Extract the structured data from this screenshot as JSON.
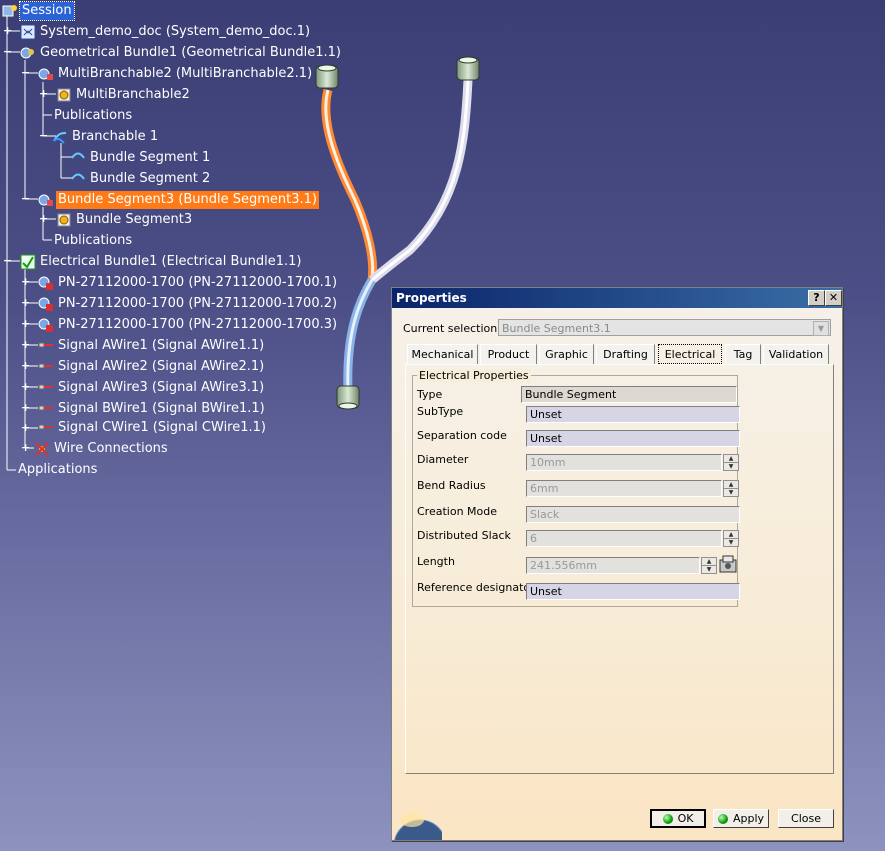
{
  "tree": {
    "items": [
      {
        "label": "Session",
        "icon": "session-icon"
      },
      {
        "label": "System_demo_doc (System_demo_doc.1)",
        "icon": "document-icon"
      },
      {
        "label": "Geometrical Bundle1 (Geometrical Bundle1.1)",
        "icon": "geometrical-bundle-icon"
      },
      {
        "label": "MultiBranchable2 (MultiBranchable2.1)",
        "icon": "multibranchable-product-icon"
      },
      {
        "label": "MultiBranchable2",
        "icon": "gear-part-icon"
      },
      {
        "label": "Publications",
        "icon": ""
      },
      {
        "label": "Branchable 1",
        "icon": "branchable-icon"
      },
      {
        "label": "Bundle Segment 1",
        "icon": "bundle-segment-icon"
      },
      {
        "label": "Bundle Segment 2",
        "icon": "bundle-segment-icon"
      },
      {
        "label": "Bundle Segment3 (Bundle Segment3.1)",
        "icon": "bundle-segment-product-icon"
      },
      {
        "label": "Bundle Segment3",
        "icon": "gear-part-icon"
      },
      {
        "label": "Publications",
        "icon": ""
      },
      {
        "label": "Electrical Bundle1 (Electrical Bundle1.1)",
        "icon": "electrical-bundle-icon"
      },
      {
        "label": "PN-27112000-1700 (PN-27112000-1700.1)",
        "icon": "connector-product-icon"
      },
      {
        "label": "PN-27112000-1700 (PN-27112000-1700.2)",
        "icon": "connector-product-icon"
      },
      {
        "label": "PN-27112000-1700 (PN-27112000-1700.3)",
        "icon": "connector-product-icon"
      },
      {
        "label": "Signal AWire1 (Signal AWire1.1)",
        "icon": "wire-icon"
      },
      {
        "label": "Signal AWire2 (Signal AWire2.1)",
        "icon": "wire-icon"
      },
      {
        "label": "Signal AWire3 (Signal AWire3.1)",
        "icon": "wire-icon"
      },
      {
        "label": "Signal BWire1 (Signal BWire1.1)",
        "icon": "wire-icon"
      },
      {
        "label": "Signal CWire1 (Signal CWire1.1)",
        "icon": "wire-icon"
      },
      {
        "label": "Wire Connections",
        "icon": "wire-connections-icon"
      },
      {
        "label": "Applications",
        "icon": ""
      }
    ]
  },
  "dialog": {
    "title": "Properties",
    "help_label": "?",
    "close_label": "✕",
    "current_selection_label": "Current selection :",
    "current_selection_value": "Bundle Segment3.1",
    "tabs": [
      "Mechanical",
      "Product",
      "Graphic",
      "Drafting",
      "Electrical",
      "Tag",
      "Validation"
    ],
    "active_tab": "Electrical",
    "group_title": "Electrical Properties",
    "properties": [
      {
        "label": "Type",
        "value": "Bundle Segment"
      },
      {
        "label": "SubType",
        "value": "Unset"
      },
      {
        "label": "Separation code",
        "value": "Unset"
      },
      {
        "label": "Diameter",
        "value": "10mm"
      },
      {
        "label": "Bend Radius",
        "value": "6mm"
      },
      {
        "label": "Creation Mode",
        "value": "Slack"
      },
      {
        "label": "Distributed Slack",
        "value": "6"
      },
      {
        "label": "Length",
        "value": "241.556mm"
      },
      {
        "label": "Reference designator",
        "value": "Unset"
      }
    ],
    "buttons": {
      "ok": "OK",
      "apply": "Apply",
      "close": "Close"
    }
  },
  "colors": {
    "selection_blue": "#2a63d6",
    "selection_orange": "#ff7b17",
    "titlebar": "#0a246a"
  }
}
